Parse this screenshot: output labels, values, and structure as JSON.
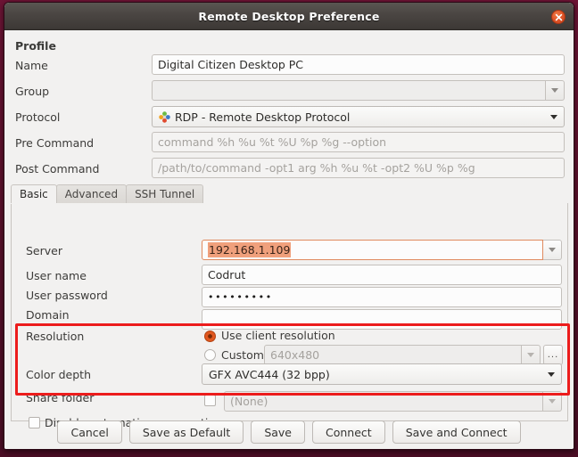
{
  "window": {
    "title": "Remote Desktop Preference",
    "close_icon": "close-icon"
  },
  "profile": {
    "section_label": "Profile",
    "fields": [
      {
        "label": "Name",
        "value": "Digital Citizen Desktop PC",
        "placeholder": ""
      },
      {
        "label": "Group",
        "value": "",
        "placeholder": ""
      },
      {
        "label": "Protocol",
        "value": "RDP - Remote Desktop Protocol",
        "placeholder": ""
      },
      {
        "label": "Pre Command",
        "value": "",
        "placeholder": "command %h %u %t %U %p %g --option"
      },
      {
        "label": "Post Command",
        "value": "",
        "placeholder": "/path/to/command -opt1 arg %h %u %t -opt2 %U %p %g"
      }
    ]
  },
  "tabs": [
    {
      "label": "Basic",
      "active": true
    },
    {
      "label": "Advanced",
      "active": false
    },
    {
      "label": "SSH Tunnel",
      "active": false
    }
  ],
  "basic": {
    "server": {
      "label": "Server",
      "value": "192.168.1.109",
      "selected": true
    },
    "user_name": {
      "label": "User name",
      "value": "Codrut"
    },
    "user_password": {
      "label": "User password",
      "value": "•••••••••"
    },
    "domain": {
      "label": "Domain",
      "value": ""
    },
    "resolution": {
      "label": "Resolution",
      "use_client_label": "Use client resolution",
      "use_client_selected": true,
      "custom_label": "Custom",
      "custom_selected": false,
      "custom_value": "640x480",
      "browse_label": "..."
    },
    "color_depth": {
      "label": "Color depth",
      "value": "GFX AVC444 (32 bpp)"
    },
    "share_folder": {
      "label": "Share folder",
      "value": "(None)",
      "checked": false
    },
    "disable_reconnect": {
      "label": "Disable automatic reconnection",
      "checked": false
    }
  },
  "buttons": [
    {
      "label": "Cancel"
    },
    {
      "label": "Save as Default"
    },
    {
      "label": "Save"
    },
    {
      "label": "Connect"
    },
    {
      "label": "Save and Connect"
    }
  ],
  "colors": {
    "accent_orange": "#e1571f",
    "annotation_red": "#ec1c1c",
    "selection_orange": "#f0a07c",
    "titlebar_dark": "#4b4643"
  }
}
